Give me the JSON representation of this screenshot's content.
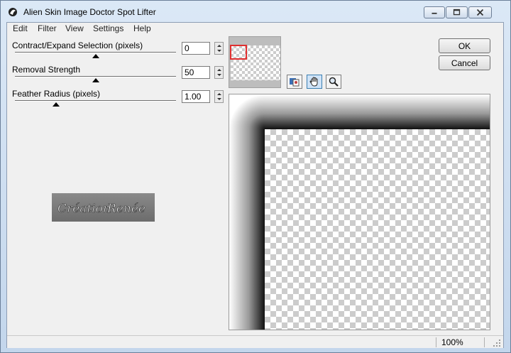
{
  "window": {
    "title": "Alien Skin Image Doctor Spot Lifter"
  },
  "menu": {
    "items": [
      "Edit",
      "Filter",
      "View",
      "Settings",
      "Help"
    ]
  },
  "params": [
    {
      "label": "Contract/Expand Selection (pixels)",
      "value": "0"
    },
    {
      "label": "Removal Strength",
      "value": "50"
    },
    {
      "label": "Feather Radius (pixels)",
      "value": "1.00"
    }
  ],
  "logo": {
    "text": "Création Renée"
  },
  "buttons": {
    "ok": "OK",
    "cancel": "Cancel"
  },
  "tools": [
    "preview-compare-icon",
    "hand-icon",
    "zoom-icon"
  ],
  "status": {
    "zoom": "100%"
  },
  "colors": {
    "title_bg": "#c9daf0",
    "nav_highlight": "#e03030"
  }
}
